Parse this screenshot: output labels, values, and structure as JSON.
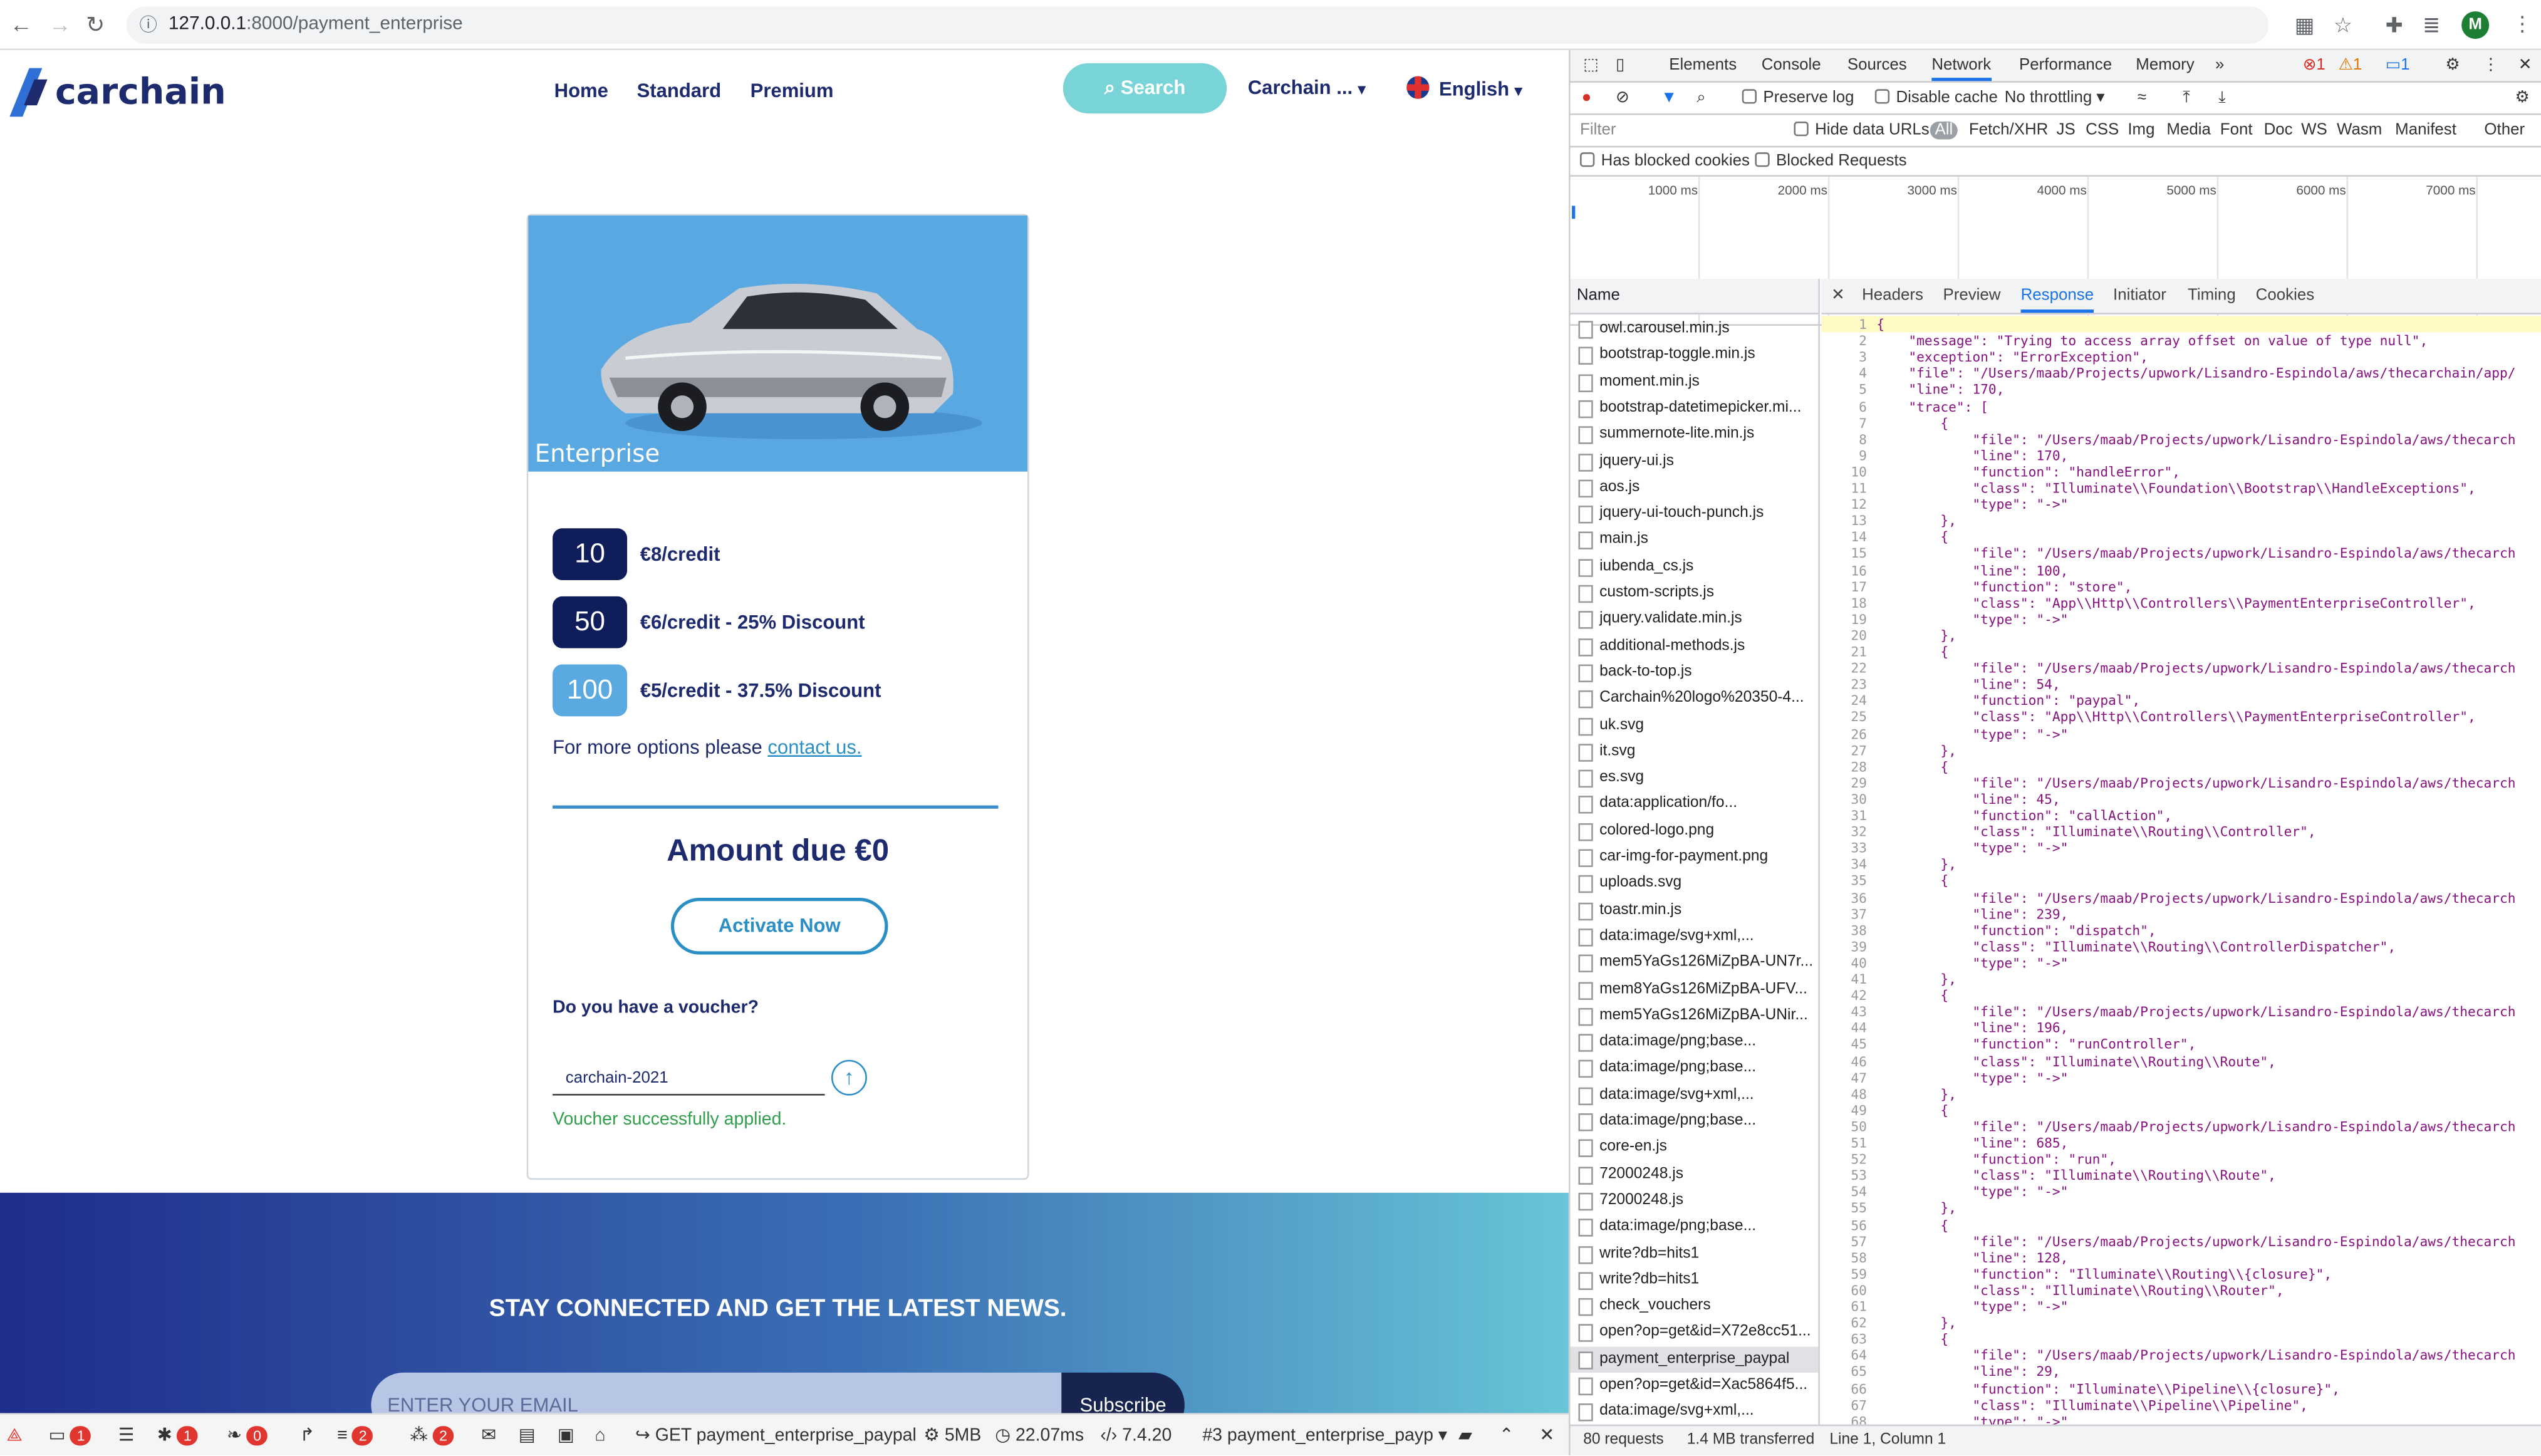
{
  "browser": {
    "url_host": "127.0.0.1",
    "url_path": ":8000/payment_enterprise",
    "avatar_letter": "M"
  },
  "site": {
    "logo": "carchain",
    "nav": [
      "Home",
      "Standard",
      "Premium"
    ],
    "search_label": "Search",
    "account_label": "Carchain ...",
    "language_label": "English",
    "card": {
      "title": "Enterprise",
      "packages": [
        {
          "amount": "10",
          "label": "€8/credit",
          "color": "#0f1d5a"
        },
        {
          "amount": "50",
          "label": "€6/credit - 25% Discount",
          "color": "#0f1d5a"
        },
        {
          "amount": "100",
          "label": "€5/credit - 37.5% Discount",
          "color": "#5aa9e0"
        }
      ],
      "more_options_text": "For more options please ",
      "contact_link": "contact us.",
      "amount_due": "Amount due €0",
      "activate_label": "Activate Now",
      "voucher_question": "Do you have a voucher?",
      "voucher_value": "carchain-2021",
      "voucher_success": "Voucher successfully applied."
    },
    "newsletter": {
      "title": "STAY CONNECTED AND GET THE LATEST NEWS.",
      "email_placeholder": "ENTER YOUR EMAIL",
      "subscribe_label": "Subscribe"
    }
  },
  "debugbar": {
    "items": [
      {
        "label": "",
        "badge": "1"
      },
      {
        "label": "",
        "badge": ""
      },
      {
        "label": "",
        "badge": "1"
      },
      {
        "label": "",
        "badge": "0"
      },
      {
        "label": "",
        "badge": ""
      },
      {
        "label": "",
        "badge": "2"
      },
      {
        "label": "",
        "badge": "2"
      }
    ],
    "request": "GET payment_enterprise_paypal",
    "memory": "5MB",
    "time": "22.07ms",
    "php": "7.4.20",
    "selector": "#3 payment_enterprise_payp"
  },
  "devtools": {
    "tabs": [
      "Elements",
      "Console",
      "Sources",
      "Network",
      "Performance",
      "Memory"
    ],
    "active_tab": "Network",
    "counters": {
      "errors": "1",
      "warnings": "1",
      "messages": "1"
    },
    "toolbar": {
      "preserve_log": "Preserve log",
      "disable_cache": "Disable cache",
      "throttling": "No throttling"
    },
    "filter": {
      "placeholder": "Filter",
      "hide_data_urls": "Hide data URLs",
      "all": "All",
      "types": [
        "Fetch/XHR",
        "JS",
        "CSS",
        "Img",
        "Media",
        "Font",
        "Doc",
        "WS",
        "Wasm",
        "Manifest",
        "Other"
      ],
      "has_blocked_cookies": "Has blocked cookies",
      "blocked_requests": "Blocked Requests"
    },
    "timeline_ticks": [
      "1000 ms",
      "2000 ms",
      "3000 ms",
      "4000 ms",
      "5000 ms",
      "6000 ms",
      "7000 ms"
    ],
    "name_header": "Name",
    "requests": [
      "owl.carousel.min.js",
      "bootstrap-toggle.min.js",
      "moment.min.js",
      "bootstrap-datetimepicker.mi...",
      "summernote-lite.min.js",
      "jquery-ui.js",
      "aos.js",
      "jquery-ui-touch-punch.js",
      "main.js",
      "iubenda_cs.js",
      "custom-scripts.js",
      "jquery.validate.min.js",
      "additional-methods.js",
      "back-to-top.js",
      "Carchain%20logo%20350-4...",
      "uk.svg",
      "it.svg",
      "es.svg",
      "data:application/fo...",
      "colored-logo.png",
      "car-img-for-payment.png",
      "uploads.svg",
      "toastr.min.js",
      "data:image/svg+xml,...",
      "mem5YaGs126MiZpBA-UN7r...",
      "mem8YaGs126MiZpBA-UFV...",
      "mem5YaGs126MiZpBA-UNir...",
      "data:image/png;base...",
      "data:image/png;base...",
      "data:image/svg+xml,...",
      "data:image/png;base...",
      "core-en.js",
      "72000248.js",
      "72000248.js",
      "data:image/png;base...",
      "write?db=hits1",
      "write?db=hits1",
      "check_vouchers",
      "open?op=get&id=X72e8cc51...",
      "payment_enterprise_paypal",
      "open?op=get&id=Xac5864f5...",
      "data:image/svg+xml,..."
    ],
    "selected_request": "payment_enterprise_paypal",
    "response_tabs": [
      "Headers",
      "Preview",
      "Response",
      "Initiator",
      "Timing",
      "Cookies"
    ],
    "active_response_tab": "Response",
    "response_lines": [
      "{",
      "    \"message\": \"Trying to access array offset on value of type null\",",
      "    \"exception\": \"ErrorException\",",
      "    \"file\": \"/Users/maab/Projects/upwork/Lisandro-Espindola/aws/thecarchain/app/",
      "    \"line\": 170,",
      "    \"trace\": [",
      "        {",
      "            \"file\": \"/Users/maab/Projects/upwork/Lisandro-Espindola/aws/thecarch",
      "            \"line\": 170,",
      "            \"function\": \"handleError\",",
      "            \"class\": \"Illuminate\\\\Foundation\\\\Bootstrap\\\\HandleExceptions\",",
      "            \"type\": \"->\"",
      "        },",
      "        {",
      "            \"file\": \"/Users/maab/Projects/upwork/Lisandro-Espindola/aws/thecarch",
      "            \"line\": 100,",
      "            \"function\": \"store\",",
      "            \"class\": \"App\\\\Http\\\\Controllers\\\\PaymentEnterpriseController\",",
      "            \"type\": \"->\"",
      "        },",
      "        {",
      "            \"file\": \"/Users/maab/Projects/upwork/Lisandro-Espindola/aws/thecarch",
      "            \"line\": 54,",
      "            \"function\": \"paypal\",",
      "            \"class\": \"App\\\\Http\\\\Controllers\\\\PaymentEnterpriseController\",",
      "            \"type\": \"->\"",
      "        },",
      "        {",
      "            \"file\": \"/Users/maab/Projects/upwork/Lisandro-Espindola/aws/thecarch",
      "            \"line\": 45,",
      "            \"function\": \"callAction\",",
      "            \"class\": \"Illuminate\\\\Routing\\\\Controller\",",
      "            \"type\": \"->\"",
      "        },",
      "        {",
      "            \"file\": \"/Users/maab/Projects/upwork/Lisandro-Espindola/aws/thecarch",
      "            \"line\": 239,",
      "            \"function\": \"dispatch\",",
      "            \"class\": \"Illuminate\\\\Routing\\\\ControllerDispatcher\",",
      "            \"type\": \"->\"",
      "        },",
      "        {",
      "            \"file\": \"/Users/maab/Projects/upwork/Lisandro-Espindola/aws/thecarch",
      "            \"line\": 196,",
      "            \"function\": \"runController\",",
      "            \"class\": \"Illuminate\\\\Routing\\\\Route\",",
      "            \"type\": \"->\"",
      "        },",
      "        {",
      "            \"file\": \"/Users/maab/Projects/upwork/Lisandro-Espindola/aws/thecarch",
      "            \"line\": 685,",
      "            \"function\": \"run\",",
      "            \"class\": \"Illuminate\\\\Routing\\\\Route\",",
      "            \"type\": \"->\"",
      "        },",
      "        {",
      "            \"file\": \"/Users/maab/Projects/upwork/Lisandro-Espindola/aws/thecarch",
      "            \"line\": 128,",
      "            \"function\": \"Illuminate\\\\Routing\\\\{closure}\",",
      "            \"class\": \"Illuminate\\\\Routing\\\\Router\",",
      "            \"type\": \"->\"",
      "        },",
      "        {",
      "            \"file\": \"/Users/maab/Projects/upwork/Lisandro-Espindola/aws/thecarch",
      "            \"line\": 29,",
      "            \"function\": \"Illuminate\\\\Pipeline\\\\{closure}\",",
      "            \"class\": \"Illuminate\\\\Pipeline\\\\Pipeline\",",
      "            \"type\": \"->\""
    ],
    "status": {
      "requests": "80 requests",
      "transferred": "1.4 MB transferred",
      "cursor": "Line 1, Column 1"
    }
  }
}
